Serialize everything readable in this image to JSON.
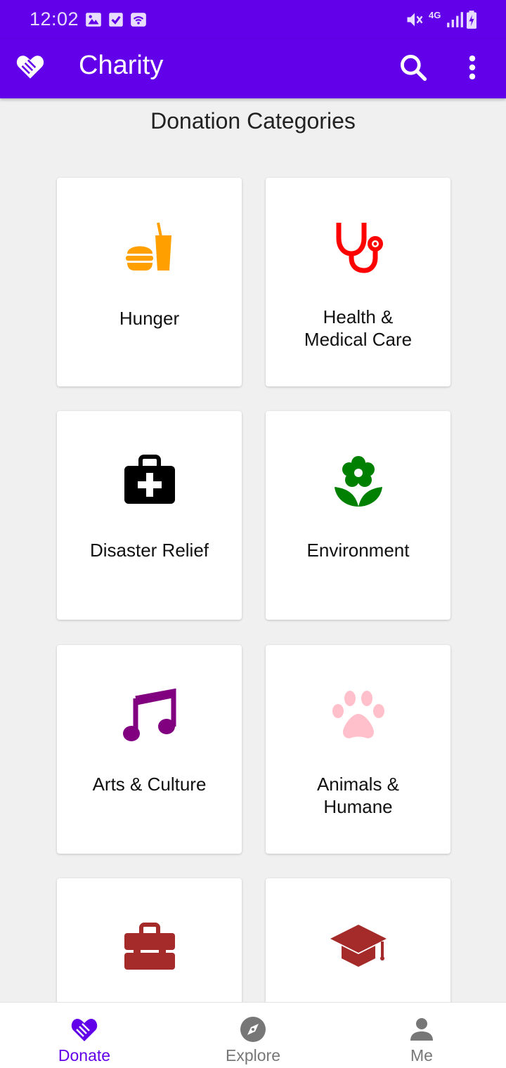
{
  "status_bar": {
    "time": "12:02",
    "network": "4G"
  },
  "app_bar": {
    "title": "Charity",
    "logo_icon": "hand-heart-icon",
    "search_icon": "search-icon",
    "menu_icon": "more-vert-icon"
  },
  "main": {
    "heading": "Donation Categories",
    "categories": [
      {
        "label": "Hunger",
        "icon": "fastfood-icon",
        "color": "#ffa000"
      },
      {
        "label": "Health &\nMedical Care",
        "icon": "stethoscope-icon",
        "color": "#ff0000"
      },
      {
        "label": "Disaster Relief",
        "icon": "medical-bag-icon",
        "color": "#000000"
      },
      {
        "label": "Environment",
        "icon": "flower-icon",
        "color": "#008000"
      },
      {
        "label": "Arts & Culture",
        "icon": "music-note-icon",
        "color": "#800080"
      },
      {
        "label": "Animals &\nHumane",
        "icon": "paw-icon",
        "color": "#ffc0cb"
      },
      {
        "label": "",
        "icon": "toolbox-icon",
        "color": "#a52a2a"
      },
      {
        "label": "",
        "icon": "graduation-cap-icon",
        "color": "#a52a2a"
      }
    ]
  },
  "bottom_nav": {
    "items": [
      {
        "label": "Donate",
        "icon": "hand-heart-icon",
        "active": true
      },
      {
        "label": "Explore",
        "icon": "compass-icon",
        "active": false
      },
      {
        "label": "Me",
        "icon": "person-icon",
        "active": false
      }
    ]
  },
  "colors": {
    "primary": "#6200ea",
    "background": "#f0f0f0",
    "inactive_nav": "#777777"
  }
}
